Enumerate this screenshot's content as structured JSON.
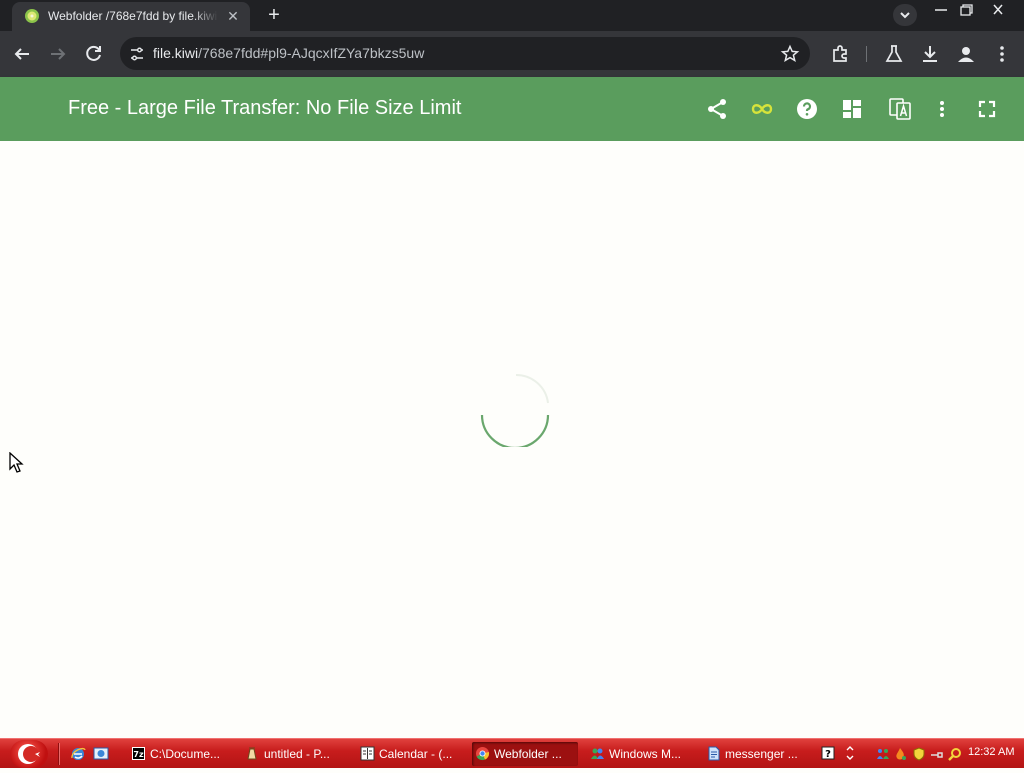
{
  "browser": {
    "tab_title": "Webfolder /768e7fdd by file.kiwi",
    "url_host": "file.kiwi",
    "url_path": "/768e7fdd#pl9-AJqcxIfZYa7bkzs5uw"
  },
  "app": {
    "title": "Free - Large File Transfer: No File Size Limit",
    "accent_color": "#5a9d5d",
    "infinity_color": "#d6e33b",
    "icons": [
      "share-icon",
      "infinity-icon",
      "help-icon",
      "dashboard-icon",
      "translate-icon",
      "more-vert-icon",
      "fullscreen-icon"
    ]
  },
  "content": {
    "state": "loading"
  },
  "taskbar": {
    "tasks": [
      {
        "label": "C:\\Docume...",
        "icon": "7zip-icon"
      },
      {
        "label": "untitled - P...",
        "icon": "paint-icon"
      },
      {
        "label": "Calendar - (...",
        "icon": "calendar-icon"
      },
      {
        "label": "Webfolder ...",
        "icon": "chrome-icon",
        "active": true
      },
      {
        "label": "Windows M...",
        "icon": "messenger-icon"
      },
      {
        "label": "messenger ...",
        "icon": "document-icon"
      }
    ],
    "clock": "12:32 AM"
  }
}
